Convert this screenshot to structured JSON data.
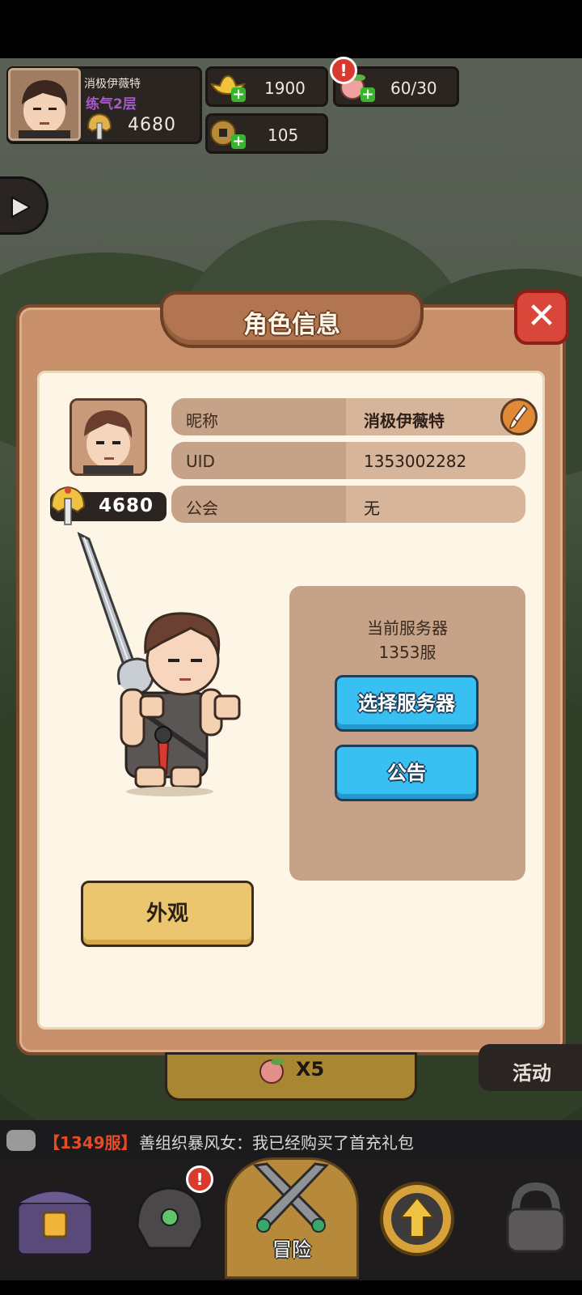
{
  "hud": {
    "player_name": "消极伊薇特",
    "rank": "练气2层",
    "power": "4680",
    "gold": "1900",
    "coins": "105",
    "stamina": "60/30",
    "stamina_badge": "!"
  },
  "dialog": {
    "title": "角色信息",
    "close_icon": "close-icon",
    "power": "4680",
    "fields": [
      {
        "label": "昵称",
        "value": "消极伊薇特"
      },
      {
        "label": "UID",
        "value": "1353002282"
      },
      {
        "label": "公会",
        "value": "无"
      }
    ],
    "server_label": "当前服务器",
    "server_value": "1353服",
    "select_server_button": "选择服务器",
    "notice_button": "公告",
    "appearance_button": "外观"
  },
  "below": {
    "reward_count": "X5",
    "activity": "活动"
  },
  "chat": {
    "server": "【1349服】",
    "message": "善组织暴风女：我已经购买了首充礼包"
  },
  "nav": {
    "adventure": "冒险",
    "badge": "!"
  },
  "colors": {
    "dialog_frame": "#c88f6b",
    "panel": "#fdf6e7",
    "blue_button": "#39c0f2",
    "yellow_button": "#ecc66e",
    "close_red": "#d9463a"
  }
}
